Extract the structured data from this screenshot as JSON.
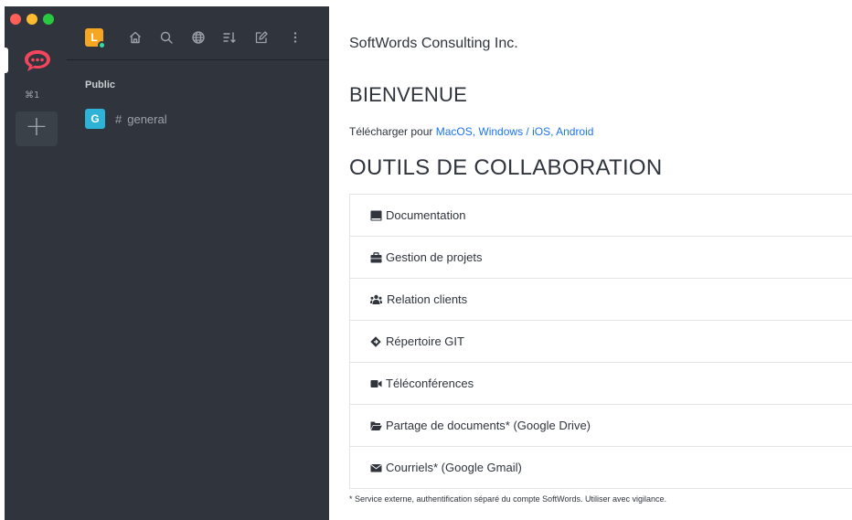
{
  "colors": {
    "rail_bg": "#2f343d",
    "accent_red": "#f5455c",
    "link_blue": "#1d74f5",
    "traffic_red": "#fe5f57",
    "traffic_yellow": "#febc2e",
    "traffic_green": "#28c840",
    "room_avatar": "#2eb3d6",
    "user_avatar": "#f5a623",
    "status_online": "#2de0a5"
  },
  "rail": {
    "shortcut": "⌘1",
    "add_label": "+"
  },
  "sidebar": {
    "user_initial": "L",
    "toolbar_icons": [
      "home-icon",
      "search-icon",
      "directory-icon",
      "sort-icon",
      "create-new-icon",
      "kebab-menu-icon"
    ],
    "section_title": "Public",
    "rooms": [
      {
        "initial": "G",
        "hash": "#",
        "name": "general"
      }
    ]
  },
  "main": {
    "org_title": "SoftWords Consulting Inc.",
    "welcome_title": "BIENVENUE",
    "download": {
      "prefix": "Télécharger pour ",
      "links_text": "MacOS, Windows / iOS, Android"
    },
    "tools_title": "OUTILS DE COLLABORATION",
    "tools": [
      {
        "icon": "book-icon",
        "label": "Documentation"
      },
      {
        "icon": "briefcase-icon",
        "label": "Gestion de projets"
      },
      {
        "icon": "users-icon",
        "label": "Relation clients"
      },
      {
        "icon": "git-icon",
        "label": "Répertoire GIT"
      },
      {
        "icon": "video-camera-icon",
        "label": "Téléconférences"
      },
      {
        "icon": "folder-open-icon",
        "label": "Partage de documents* (Google Drive)"
      },
      {
        "icon": "envelope-icon",
        "label": "Courriels* (Google Gmail)"
      }
    ],
    "footnote": "* Service externe, authentification séparé du compte SoftWords. Utiliser avec vigilance."
  }
}
